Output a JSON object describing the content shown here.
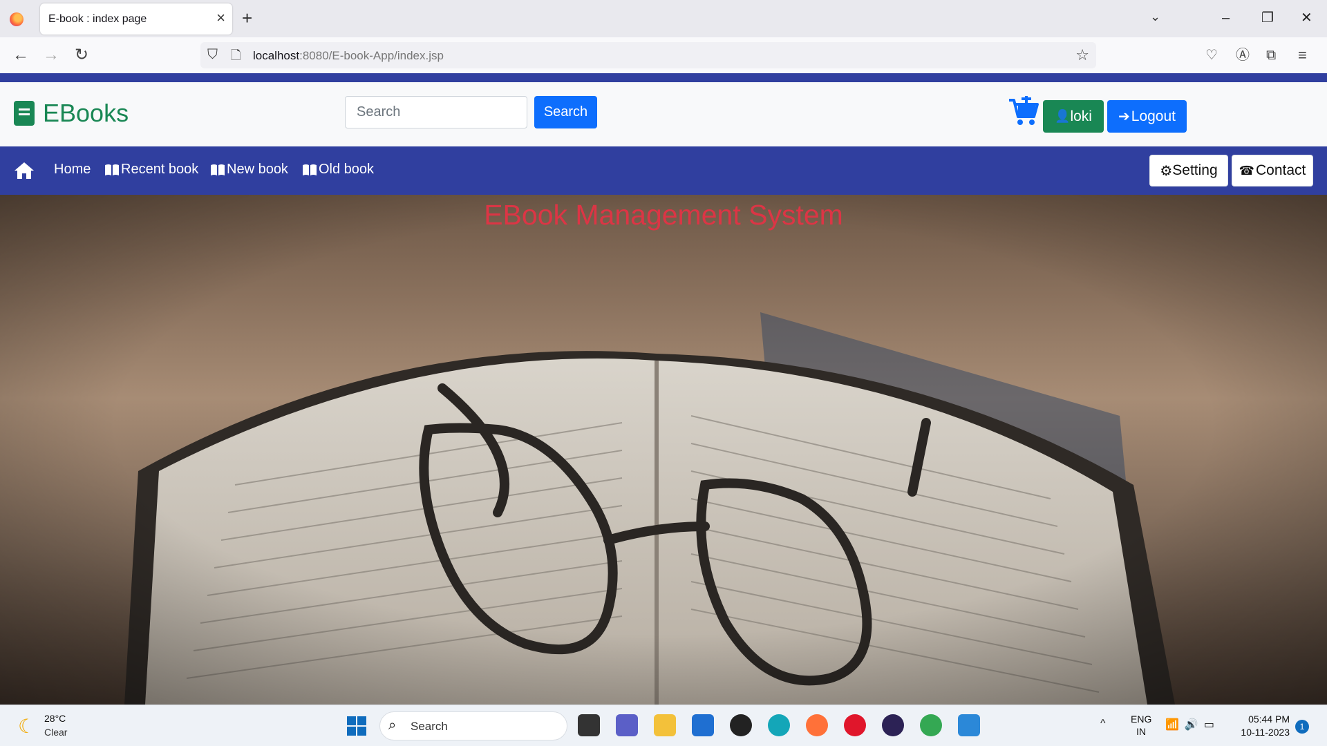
{
  "browser": {
    "tab_title": "E-book : index page",
    "url_host": "localhost",
    "url_path": ":8080/E-book-App/index.jsp"
  },
  "header": {
    "brand": "EBooks",
    "search_placeholder": "Search",
    "search_button": "Search",
    "user_label": "loki",
    "logout_label": "Logout"
  },
  "nav": {
    "home": "Home",
    "recent": "Recent book",
    "new": "New book",
    "old": "Old book",
    "setting": "Setting",
    "contact": "Contact"
  },
  "hero": {
    "title": "EBook Management System"
  },
  "taskbar": {
    "temperature": "28°C",
    "weather": "Clear",
    "search": "Search",
    "lang_top": "ENG",
    "lang_bottom": "IN",
    "time": "05:44 PM",
    "date": "10-11-2023",
    "notifications": "1"
  },
  "colors": {
    "brand_green": "#198754",
    "primary_blue": "#0d6efd",
    "nav_indigo": "#303f9f",
    "title_red": "#dc3545"
  }
}
